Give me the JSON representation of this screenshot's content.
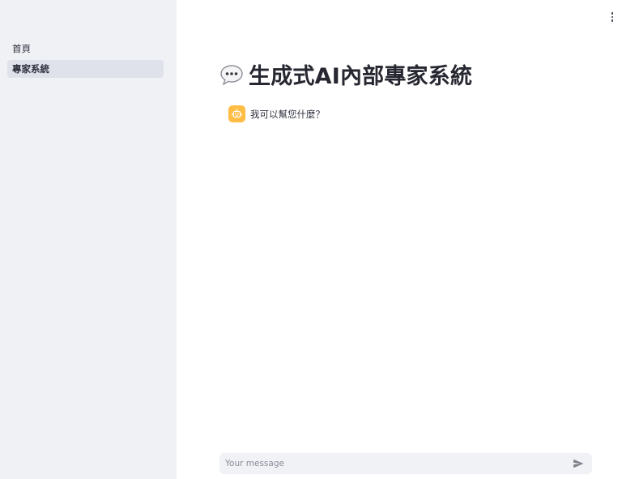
{
  "sidebar": {
    "items": [
      {
        "label": "首頁",
        "active": false
      },
      {
        "label": "專家系統",
        "active": true
      }
    ]
  },
  "header": {
    "menu_icon": "kebab-menu-icon"
  },
  "main": {
    "title_icon": "speech-bubble-icon",
    "title": "生成式AI內部專家系統",
    "messages": [
      {
        "role": "assistant",
        "avatar_icon": "robot-icon",
        "text": "我可以幫您什麼？"
      }
    ]
  },
  "chat_input": {
    "placeholder": "Your message",
    "value": "",
    "send_icon": "send-icon"
  },
  "colors": {
    "sidebar_bg": "#eff1f5",
    "active_item_bg": "#dfe2ea",
    "avatar_bg": "#ffbd45",
    "input_bg": "#f0f2f6",
    "text": "#31333f"
  }
}
